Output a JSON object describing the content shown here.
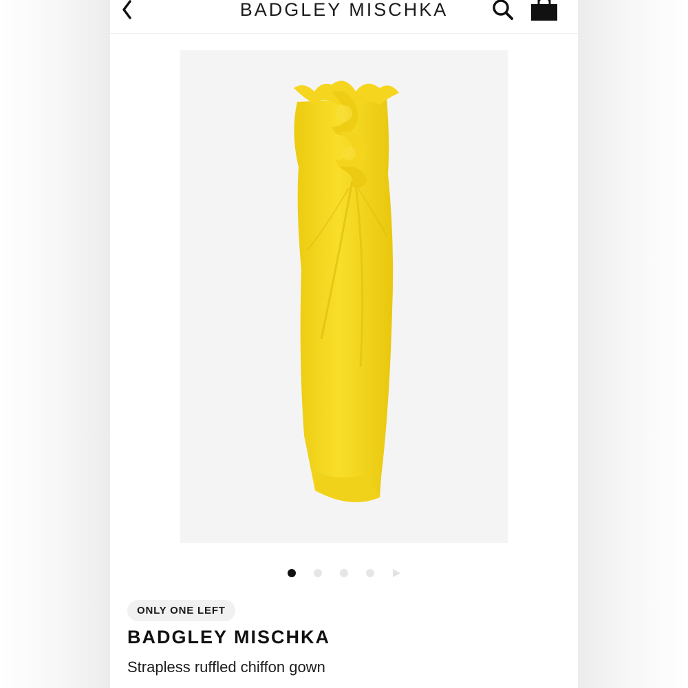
{
  "header": {
    "brand": "BADGLEY MISCHKA",
    "back_icon": "chevron-left-icon",
    "search_icon": "search-icon",
    "bag_icon": "shopping-bag-icon"
  },
  "product": {
    "image_description_color": "#f5d81f",
    "carousel": {
      "total": 4,
      "active_index": 1,
      "has_next_arrow": true
    },
    "stock_badge": "ONLY ONE LEFT",
    "brand": "BADGLEY MISCHKA",
    "name": "Strapless ruffled chiffon gown"
  },
  "colors": {
    "dress_yellow": "#f5d81f",
    "image_background": "#f4f4f4",
    "text_dark": "#111111"
  }
}
